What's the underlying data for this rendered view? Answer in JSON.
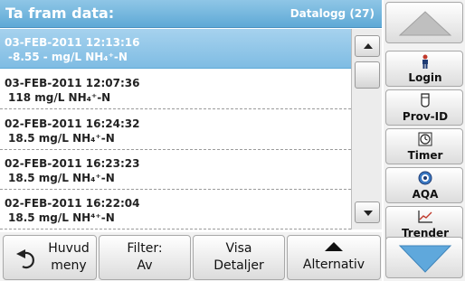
{
  "header": {
    "title": "Ta fram data:",
    "count": "Datalogg (27)"
  },
  "list": [
    {
      "line1": "03-FEB-2011  12:13:16",
      "line2": "-8.55  -  mg/L  NH₄⁺-N",
      "selected": true
    },
    {
      "line1": "03-FEB-2011  12:07:36",
      "line2": "118  mg/L  NH₄⁺-N",
      "selected": false
    },
    {
      "line1": "02-FEB-2011  16:24:32",
      "line2": "18.5  mg/L  NH₄⁺-N",
      "selected": false
    },
    {
      "line1": "02-FEB-2011  16:23:23",
      "line2": "18.5  mg/L  NH₄⁺-N",
      "selected": false
    },
    {
      "line1": "02-FEB-2011  16:22:04",
      "line2": "18.5  mg/L  NH⁴⁺-N",
      "selected": false
    }
  ],
  "side": [
    {
      "label": "Login",
      "icon": "person-icon"
    },
    {
      "label": "Prov-ID",
      "icon": "vial-icon"
    },
    {
      "label": "Timer",
      "icon": "timer-icon"
    },
    {
      "label": "AQA",
      "icon": "aqa-icon"
    },
    {
      "label": "Trender",
      "icon": "trend-chart-icon"
    }
  ],
  "bottom": {
    "home": {
      "line1": "Huvud",
      "line2": "meny"
    },
    "filter": {
      "line1": "Filter:",
      "line2": "Av"
    },
    "details": {
      "line1": "Visa",
      "line2": "Detaljer"
    },
    "options": {
      "line1": "Alternativ"
    }
  },
  "colors": {
    "accent": "#5ea9d6",
    "selected_row": "#7fbce3"
  }
}
